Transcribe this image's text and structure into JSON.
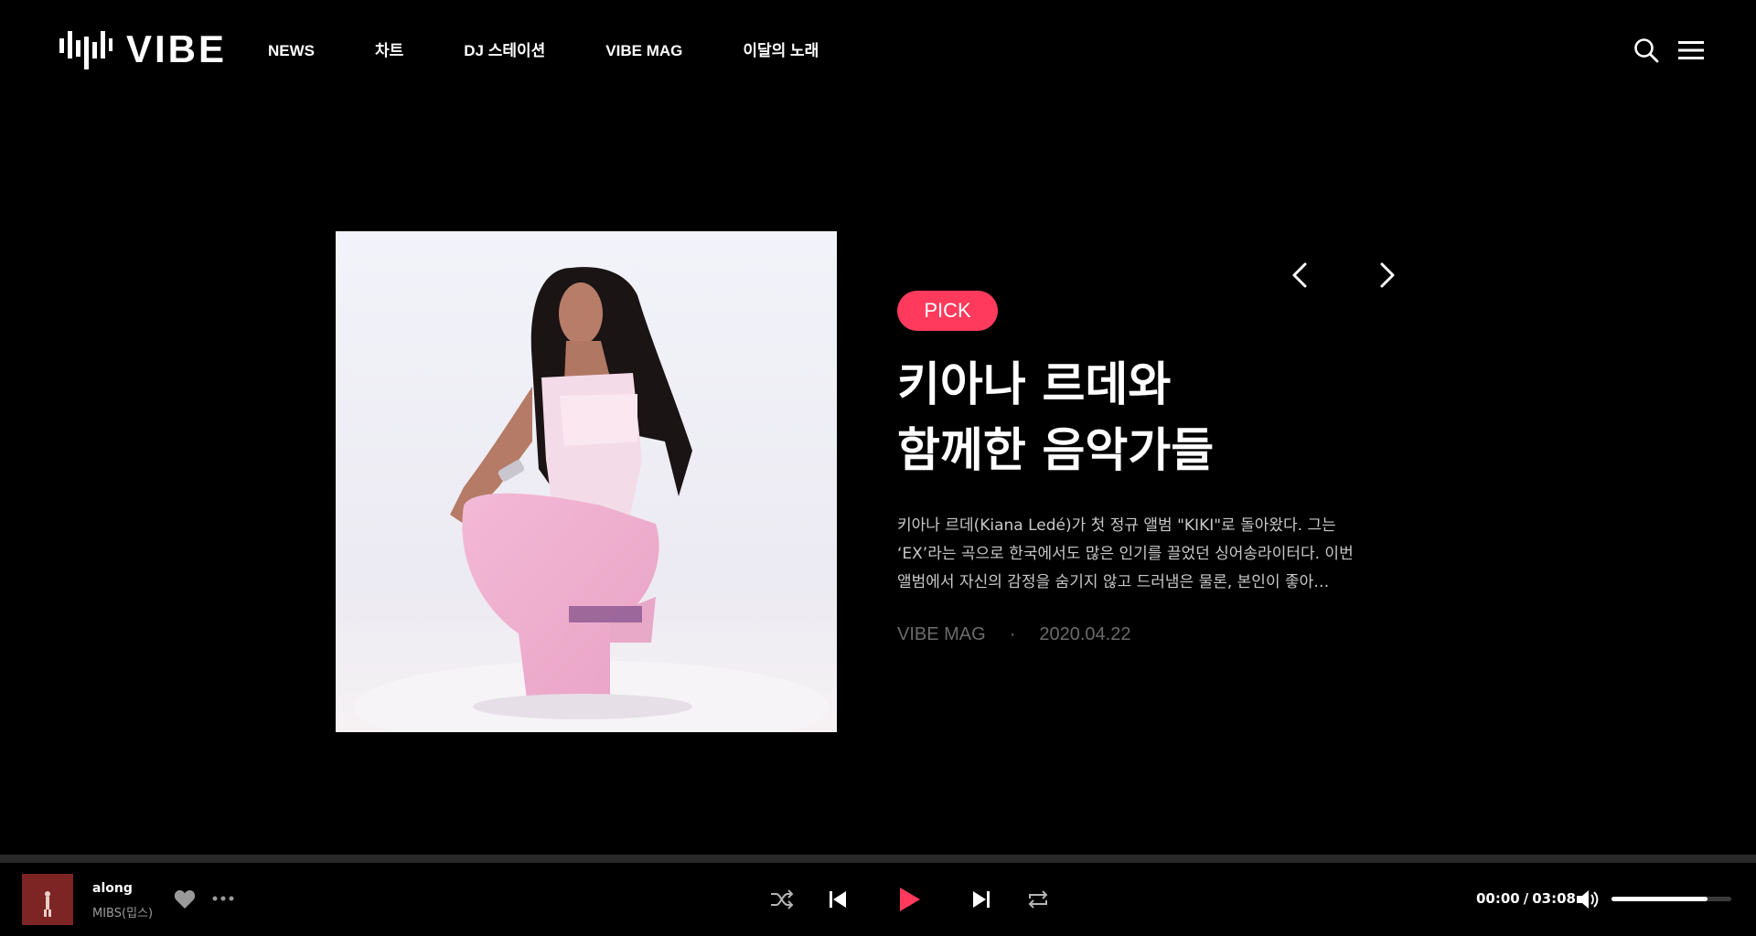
{
  "brand": {
    "name": "VIBE"
  },
  "nav": {
    "items": [
      "NEWS",
      "차트",
      "DJ 스테이션",
      "VIBE MAG",
      "이달의 노래"
    ]
  },
  "header_icons": [
    "search-icon",
    "menu-icon"
  ],
  "feature": {
    "badge": "PICK",
    "title_lines": [
      "키아나 르데와",
      "함께한 음악가들"
    ],
    "description_lines": [
      "키아나 르데(Kiana Ledé)가 첫 정규 앨범 \"KIKI\"로 돌아왔다. 그는",
      "‘EX’라는 곡으로 한국에서도 많은 인기를 끌었던 싱어송라이터다. 이번",
      "앨범에서 자신의 감정을 숨기지 않고 드러냄은 물론, 본인이 좋아…"
    ],
    "source": "VIBE MAG",
    "separator": "·",
    "date": "2020.04.22",
    "nav_icons": [
      "chevron-left-icon",
      "chevron-right-icon"
    ]
  },
  "player": {
    "track_title": "along",
    "artist": "MIBS(밉스)",
    "current_time": "00:00",
    "time_separator": "/",
    "total_time": "03:08",
    "volume": 0.8,
    "progress": 0,
    "accent_color": "#ff3a5c"
  },
  "colors": {
    "background": "#000000",
    "accent": "#ff3a5c",
    "text_muted": "#6b6b6b"
  }
}
